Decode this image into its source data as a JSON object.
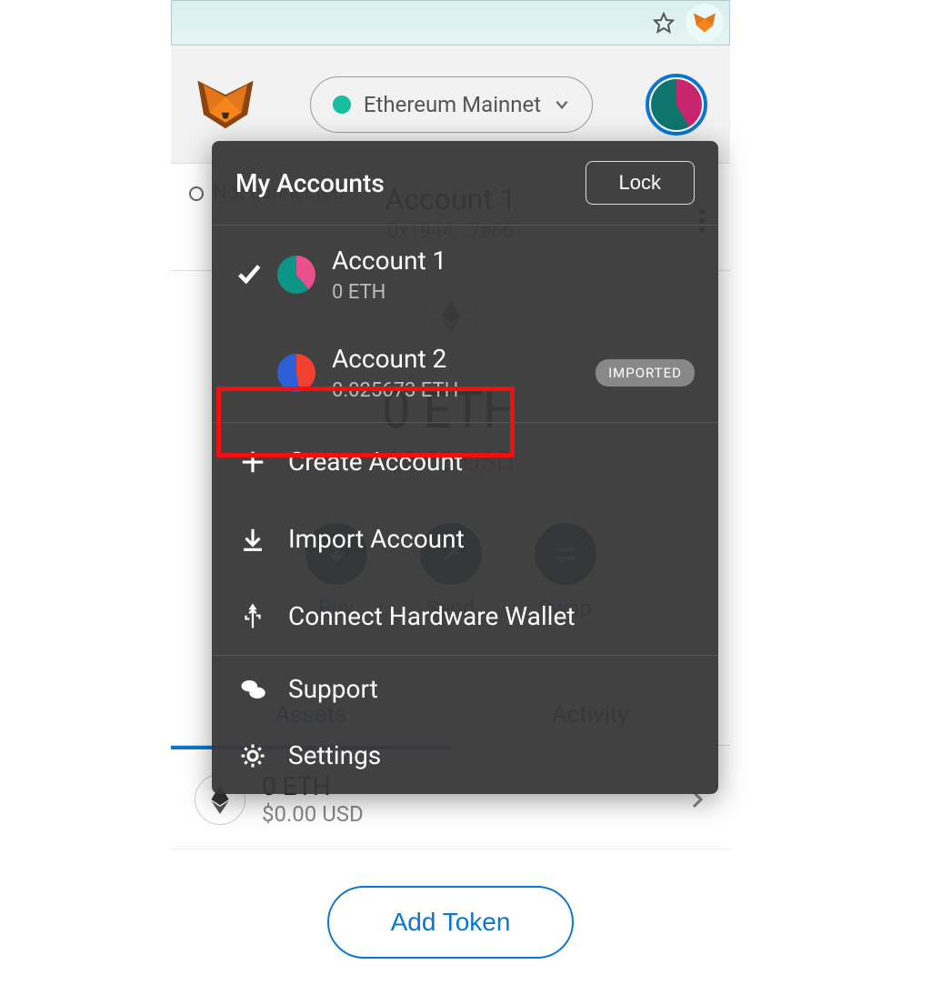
{
  "browser": {
    "star_icon": "star",
    "ext_icon": "fox"
  },
  "header": {
    "network": "Ethereum Mainnet"
  },
  "body": {
    "not_connected": "Not connected",
    "account_name": "Account 1",
    "address": "0x1944...7e66",
    "balance_main": "0 ETH",
    "balance_usd": "$0.00 USD",
    "actions": {
      "buy": "Buy",
      "send": "Send",
      "swap": "Swap"
    },
    "tabs": {
      "assets": "Assets",
      "activity": "Activity"
    },
    "token": {
      "amount": "0 ETH",
      "usd": "$0.00 USD"
    },
    "add_token": "Add Token"
  },
  "dropdown": {
    "title": "My Accounts",
    "lock": "Lock",
    "accounts": [
      {
        "name": "Account 1",
        "balance": "0 ETH",
        "selected": true,
        "imported": false
      },
      {
        "name": "Account 2",
        "balance": "0.025673 ETH",
        "selected": false,
        "imported": true
      }
    ],
    "imported_label": "IMPORTED",
    "menu": {
      "create": "Create Account",
      "import": "Import Account",
      "hardware": "Connect Hardware Wallet",
      "support": "Support",
      "settings": "Settings"
    }
  }
}
